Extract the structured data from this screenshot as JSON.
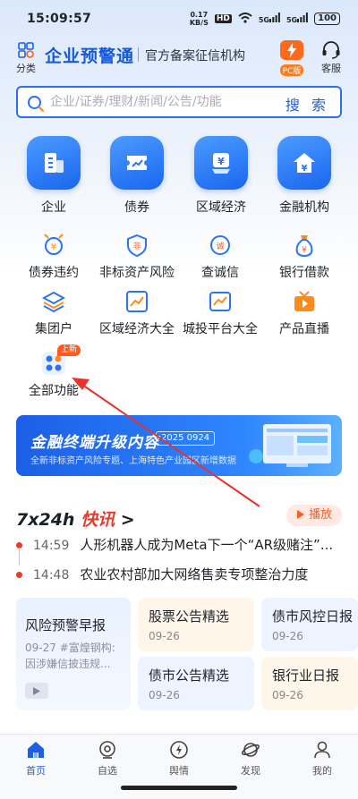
{
  "status": {
    "time": "15:09:57",
    "net_speed": "0.17",
    "net_unit": "KB/S",
    "hd": "HD",
    "sig1": "5G",
    "sig2": "5G",
    "battery": "100"
  },
  "header": {
    "category_label": "分类",
    "logo": "企业预警通",
    "slogan": "官方备案征信机构",
    "pc_label": "PC版",
    "service_label": "客服"
  },
  "search": {
    "placeholder": "企业/证券/理财/新闻/公告/功能",
    "button": "搜 索"
  },
  "main_grid": {
    "items": [
      {
        "label": "企业"
      },
      {
        "label": "债券"
      },
      {
        "label": "区域经济"
      },
      {
        "label": "金融机构"
      }
    ]
  },
  "tools": {
    "row1": [
      {
        "label": "债券违约"
      },
      {
        "label": "非标资产风险"
      },
      {
        "label": "查诚信"
      },
      {
        "label": "银行借款"
      }
    ],
    "row2": [
      {
        "label": "集团户"
      },
      {
        "label": "区域经济大全"
      },
      {
        "label": "城投平台大全"
      },
      {
        "label": "产品直播"
      }
    ],
    "all": {
      "label": "全部功能",
      "badge": "上新"
    }
  },
  "banner": {
    "title": "金融终端升级内容",
    "date": "2025 0924",
    "subtitle": "全新非标资产风险专题、上海特色产业园区新增数据"
  },
  "news": {
    "title_prefix": "7x24h",
    "title_red": "快讯",
    "title_arrow": ">",
    "play_label": "播放",
    "items": [
      {
        "time": "14:59",
        "text": "人形机器人成为Meta下一个“AR级赌注”..."
      },
      {
        "time": "14:48",
        "text": "农业农村部加大网络售卖专项整治力度"
      }
    ]
  },
  "feature_cards": {
    "left": {
      "title": "风险预警早报",
      "desc": "09-27 #富煌钢构: 因涉嫌信披违规..."
    },
    "grid": [
      {
        "title": "股票公告精选",
        "date": "09-26"
      },
      {
        "title": "债市风控日报",
        "date": "09-26"
      },
      {
        "title": "债市公告精选",
        "date": "09-26"
      },
      {
        "title": "银行业日报",
        "date": "09-26"
      }
    ]
  },
  "bottom_nav": [
    {
      "label": "首页"
    },
    {
      "label": "自选"
    },
    {
      "label": "舆情"
    },
    {
      "label": "发现"
    },
    {
      "label": "我的"
    }
  ],
  "colors": {
    "primary": "#1d5fe0",
    "accent": "#ff5a1f",
    "alert": "#e63a2a"
  }
}
